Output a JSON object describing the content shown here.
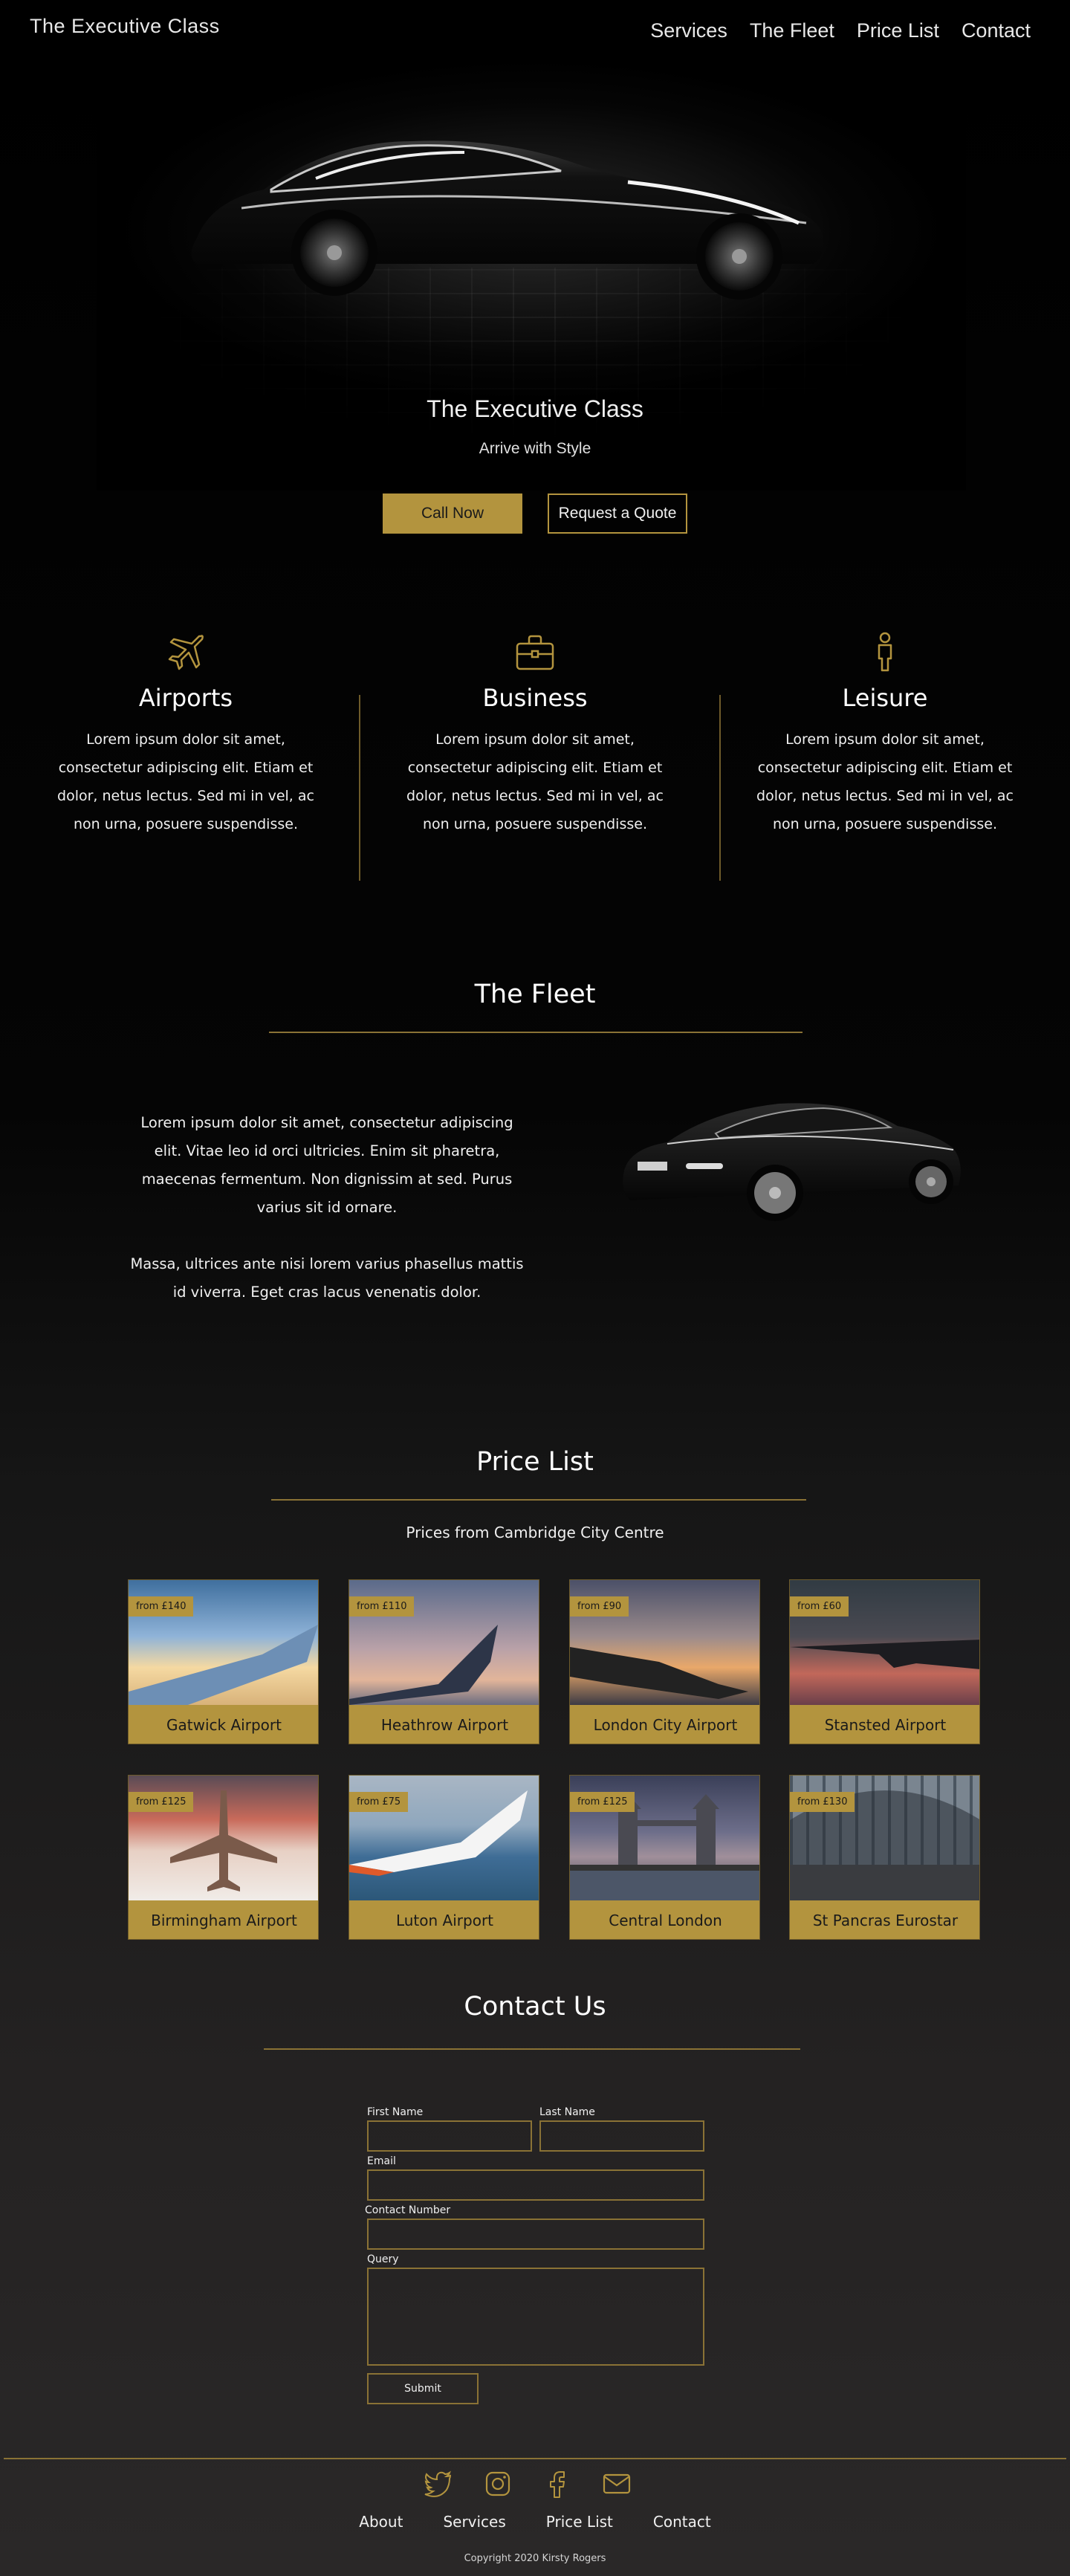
{
  "header": {
    "brand": "The Executive Class",
    "nav": [
      "Services",
      "The Fleet",
      "Price List",
      "Contact"
    ]
  },
  "hero": {
    "title": "The Executive Class",
    "subtitle": "Arrive with Style",
    "call_button": "Call Now",
    "quote_button": "Request a Quote"
  },
  "services": [
    {
      "icon": "airplane-icon",
      "title": "Airports",
      "text": "Lorem ipsum dolor sit amet, consectetur adipiscing elit. Etiam et dolor, netus lectus. Sed mi in vel, ac non urna, posuere suspendisse."
    },
    {
      "icon": "briefcase-icon",
      "title": "Business",
      "text": "Lorem ipsum dolor sit amet, consectetur adipiscing elit. Etiam et dolor, netus lectus. Sed mi in vel, ac non urna, posuere suspendisse."
    },
    {
      "icon": "person-icon",
      "title": "Leisure",
      "text": "Lorem ipsum dolor sit amet, consectetur adipiscing elit. Etiam et dolor, netus lectus. Sed mi in vel, ac non urna, posuere suspendisse."
    }
  ],
  "fleet": {
    "title": "The Fleet",
    "paragraph1": "Lorem ipsum dolor sit amet, consectetur adipiscing elit. Vitae leo id orci ultricies. Enim sit pharetra, maecenas fermentum. Non dignissim at sed. Purus varius sit id ornare.",
    "paragraph2": "Massa, ultrices ante nisi lorem varius phasellus mattis id viverra. Eget cras lacus venenatis dolor."
  },
  "prices": {
    "title": "Price List",
    "subtitle": "Prices from Cambridge City Centre",
    "cards": [
      {
        "price": "from £140",
        "name": "Gatwick Airport"
      },
      {
        "price": "from £110",
        "name": "Heathrow Airport"
      },
      {
        "price": "from £90",
        "name": "London City Airport"
      },
      {
        "price": "from £60",
        "name": "Stansted Airport"
      },
      {
        "price": "from £125",
        "name": "Birmingham Airport"
      },
      {
        "price": "from £75",
        "name": "Luton Airport"
      },
      {
        "price": "from £125",
        "name": "Central London"
      },
      {
        "price": "from £130",
        "name": "St Pancras Eurostar"
      }
    ]
  },
  "contact": {
    "title": "Contact Us",
    "first_name": "First Name",
    "last_name": "Last Name",
    "email": "Email",
    "phone": "Contact Number",
    "query": "Query",
    "submit": "Submit"
  },
  "footer": {
    "social": [
      "twitter-icon",
      "instagram-icon",
      "facebook-icon",
      "mail-icon"
    ],
    "nav": [
      "About",
      "Services",
      "Price List",
      "Contact"
    ],
    "copyright": "Copyright 2020 Kirsty Rogers"
  },
  "colors": {
    "accent": "#b3943e",
    "background": "#000000",
    "footer_background": "#2a2828"
  }
}
